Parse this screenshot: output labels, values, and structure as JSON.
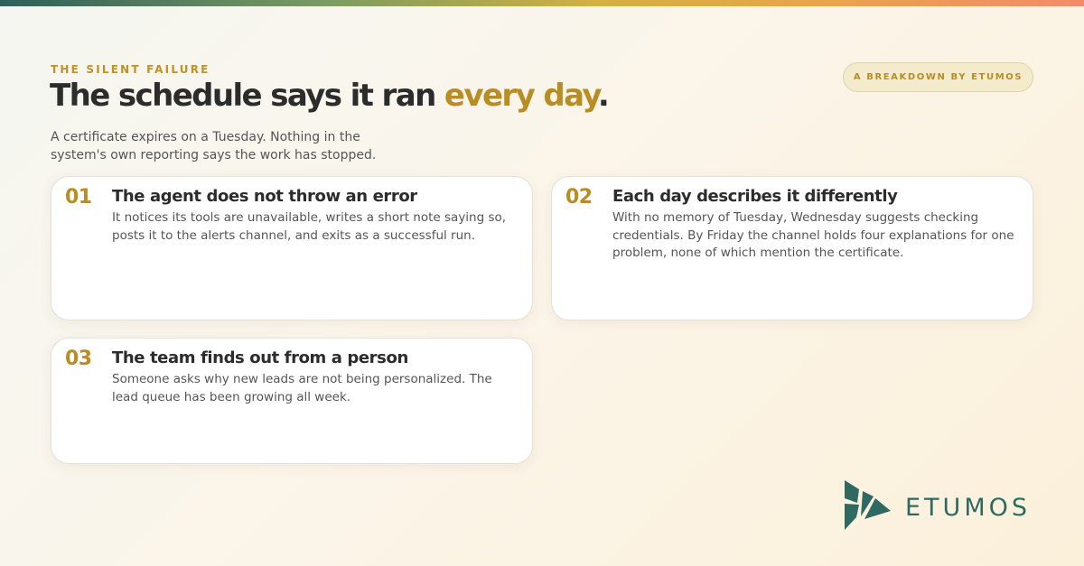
{
  "header": {
    "eyebrow": "THE SILENT FAILURE",
    "title_main": "The schedule says it ran ",
    "title_accent": "every day",
    "title_end": ".",
    "subtitle": "A certificate expires on a Tuesday. Nothing in the system's own reporting says the work has stopped.",
    "badge": "A BREAKDOWN BY ETUMOS"
  },
  "cards": [
    {
      "number": "01",
      "title": "The agent does not throw an error",
      "body": "It notices its tools are unavailable, writes a short note saying so, posts it to the alerts channel, and exits as a successful run."
    },
    {
      "number": "02",
      "title": "Each day describes it differently",
      "body": "With no memory of Tuesday, Wednesday suggests checking credentials. By Friday the channel holds four explanations for one problem, none of which mention the certificate."
    },
    {
      "number": "03",
      "title": "The team finds out from a person",
      "body": "Someone asks why new leads are not being personalized. The lead queue has been growing all week."
    }
  ],
  "brand": {
    "name": "ETUMOS",
    "icon": "etumos-logo-icon",
    "color": "#2f6a62"
  },
  "colors": {
    "accent": "#b88d23",
    "text": "#2c2c2c",
    "muted": "#555555"
  }
}
